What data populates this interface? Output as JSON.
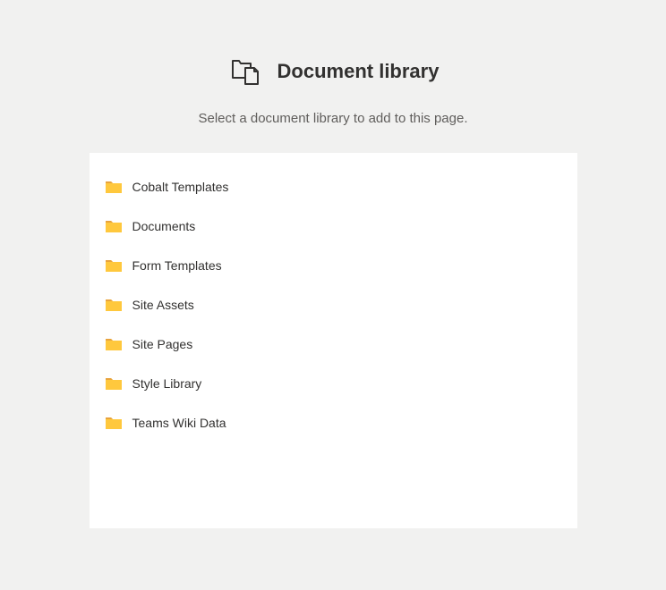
{
  "header": {
    "title": "Document library",
    "subtitle": "Select a document library to add to this page."
  },
  "libraries": [
    {
      "name": "Cobalt Templates"
    },
    {
      "name": "Documents"
    },
    {
      "name": "Form Templates"
    },
    {
      "name": "Site Assets"
    },
    {
      "name": "Site Pages"
    },
    {
      "name": "Style Library"
    },
    {
      "name": "Teams Wiki Data"
    }
  ]
}
